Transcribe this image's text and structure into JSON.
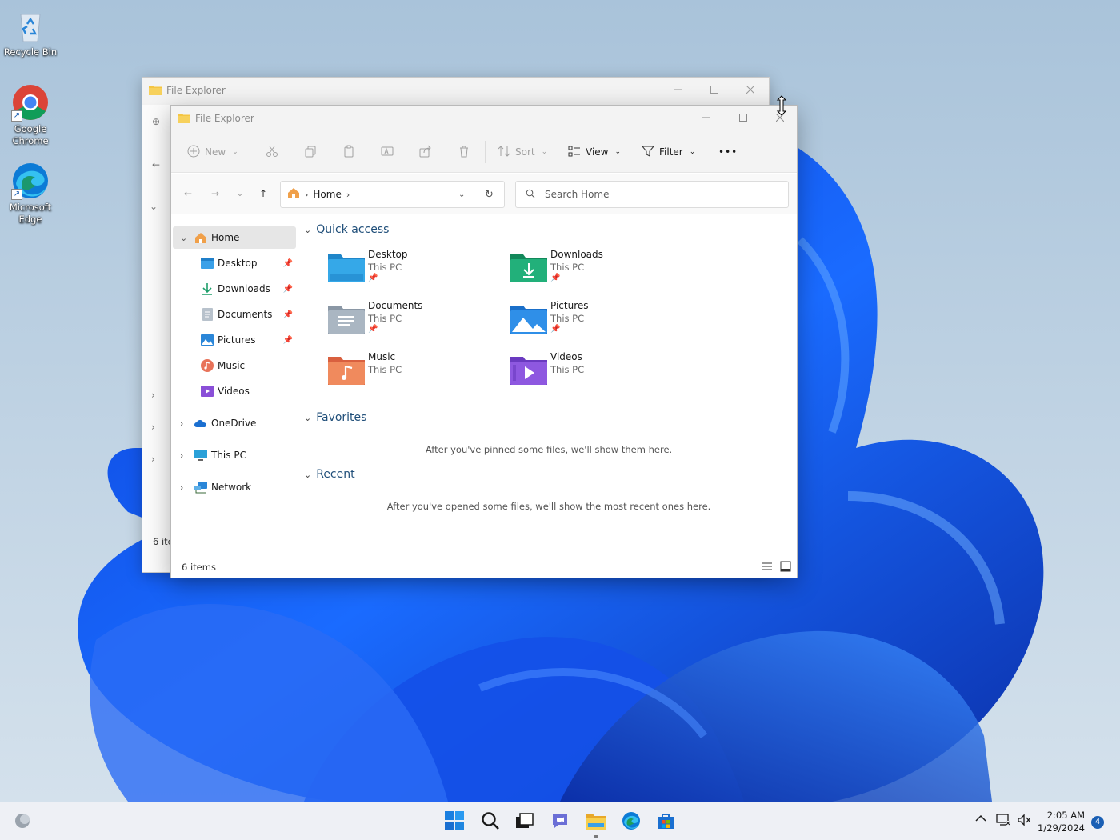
{
  "desktop": {
    "icons": [
      {
        "label": "Recycle Bin",
        "icon": "recycle-bin-icon"
      },
      {
        "label": "Google Chrome",
        "icon": "chrome-icon"
      },
      {
        "label": "Microsoft Edge",
        "icon": "edge-icon"
      }
    ]
  },
  "back_window": {
    "title": "File Explorer",
    "status_fragment": "6 ite"
  },
  "window": {
    "title": "File Explorer",
    "toolbar": {
      "new_label": "New",
      "sort_label": "Sort",
      "view_label": "View",
      "filter_label": "Filter",
      "more_label": "•••"
    },
    "address": {
      "crumb": "Home",
      "search_placeholder": "Search Home"
    },
    "nav": {
      "items": [
        {
          "label": "Home",
          "icon": "home-icon",
          "selected": true
        },
        {
          "label": "Desktop",
          "icon": "desktop-folder-icon",
          "pinned": true
        },
        {
          "label": "Downloads",
          "icon": "downloads-icon",
          "pinned": true
        },
        {
          "label": "Documents",
          "icon": "documents-icon",
          "pinned": true
        },
        {
          "label": "Pictures",
          "icon": "pictures-icon",
          "pinned": true
        },
        {
          "label": "Music",
          "icon": "music-icon"
        },
        {
          "label": "Videos",
          "icon": "videos-icon"
        },
        {
          "label": "OneDrive",
          "icon": "onedrive-icon"
        },
        {
          "label": "This PC",
          "icon": "this-pc-icon"
        },
        {
          "label": "Network",
          "icon": "network-icon"
        }
      ]
    },
    "content": {
      "quick_access": {
        "heading": "Quick access",
        "items": [
          {
            "name": "Desktop",
            "location": "This PC",
            "pinned": true
          },
          {
            "name": "Downloads",
            "location": "This PC",
            "pinned": true
          },
          {
            "name": "Documents",
            "location": "This PC",
            "pinned": true
          },
          {
            "name": "Pictures",
            "location": "This PC",
            "pinned": true
          },
          {
            "name": "Music",
            "location": "This PC",
            "pinned": false
          },
          {
            "name": "Videos",
            "location": "This PC",
            "pinned": false
          }
        ]
      },
      "favorites": {
        "heading": "Favorites",
        "empty_message": "After you've pinned some files, we'll show them here."
      },
      "recent": {
        "heading": "Recent",
        "empty_message": "After you've opened some files, we'll show the most recent ones here."
      }
    },
    "status": {
      "item_count": "6 items"
    }
  },
  "taskbar": {
    "clock_time": "2:05 AM",
    "clock_date": "1/29/2024",
    "notification_count": "4"
  },
  "colors": {
    "accent": "#1a5fb4",
    "section_heading": "#1f4e79",
    "folder_yellow": "#f4c542"
  }
}
